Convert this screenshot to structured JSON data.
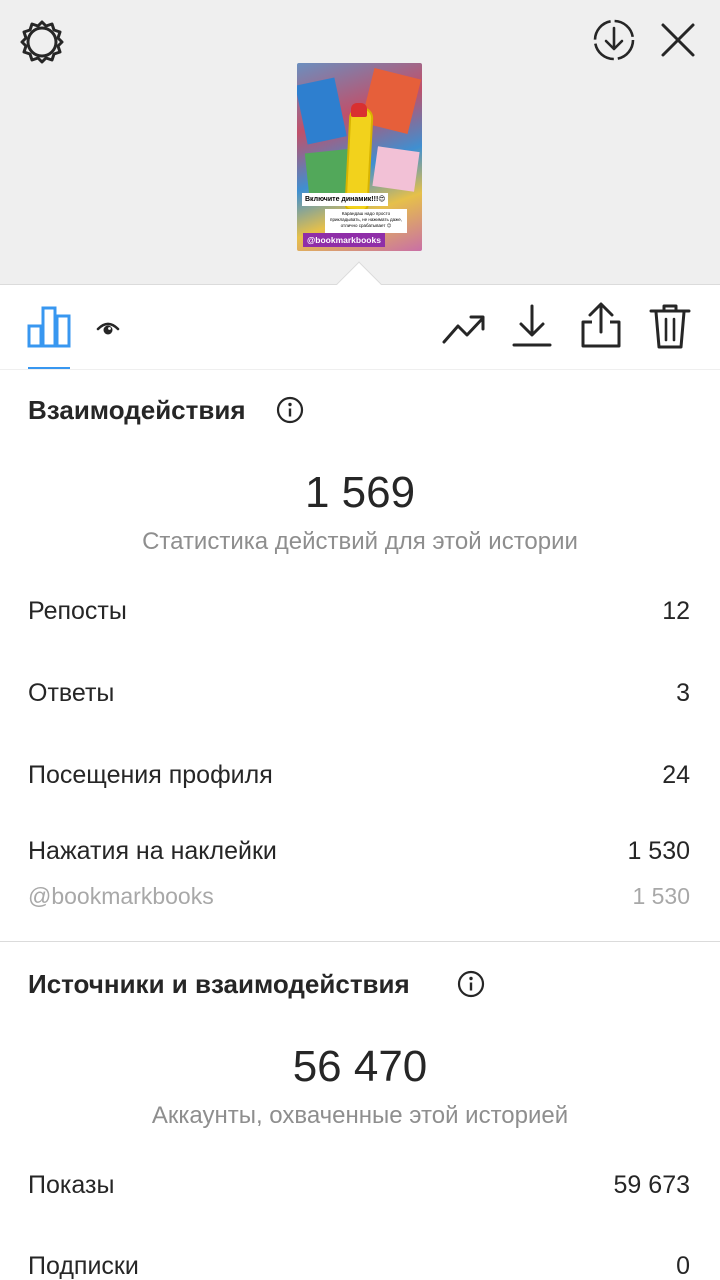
{
  "story_preview": {
    "caption_title": "Включите динамик!!!😍",
    "caption_text": "Карандаш надо просто прикладывать, не нажимать даже, отлично срабатывает 😉",
    "sticker_handle": "@bookmarkbooks"
  },
  "top_bar": {
    "settings_icon": "settings-gear-icon",
    "download_icon": "download-circle-icon",
    "close_icon": "close-icon"
  },
  "toolbar": {
    "tabs": [
      {
        "name": "insights",
        "icon": "bar-chart-icon",
        "active": true
      },
      {
        "name": "viewers",
        "icon": "eye-icon",
        "active": false
      }
    ],
    "actions": [
      "trend-up-icon",
      "download-icon",
      "share-icon",
      "trash-icon"
    ],
    "accent_color": "#3897f0"
  },
  "interactions": {
    "title": "Взаимодействия",
    "total": "1 569",
    "caption": "Статистика действий для этой истории",
    "rows": [
      {
        "label": "Репосты",
        "value": "12"
      },
      {
        "label": "Ответы",
        "value": "3"
      },
      {
        "label": "Посещения профиля",
        "value": "24"
      },
      {
        "label": "Нажатия на наклейки",
        "value": "1 530"
      }
    ],
    "sticker_breakdown": {
      "label": "@bookmarkbooks",
      "value": "1 530"
    }
  },
  "discovery": {
    "title": "Источники и взаимодействия",
    "total": "56 470",
    "caption": "Аккаунты, охваченные этой историей",
    "rows": [
      {
        "label": "Показы",
        "value": "59 673"
      },
      {
        "label": "Подписки",
        "value": "0"
      }
    ]
  }
}
